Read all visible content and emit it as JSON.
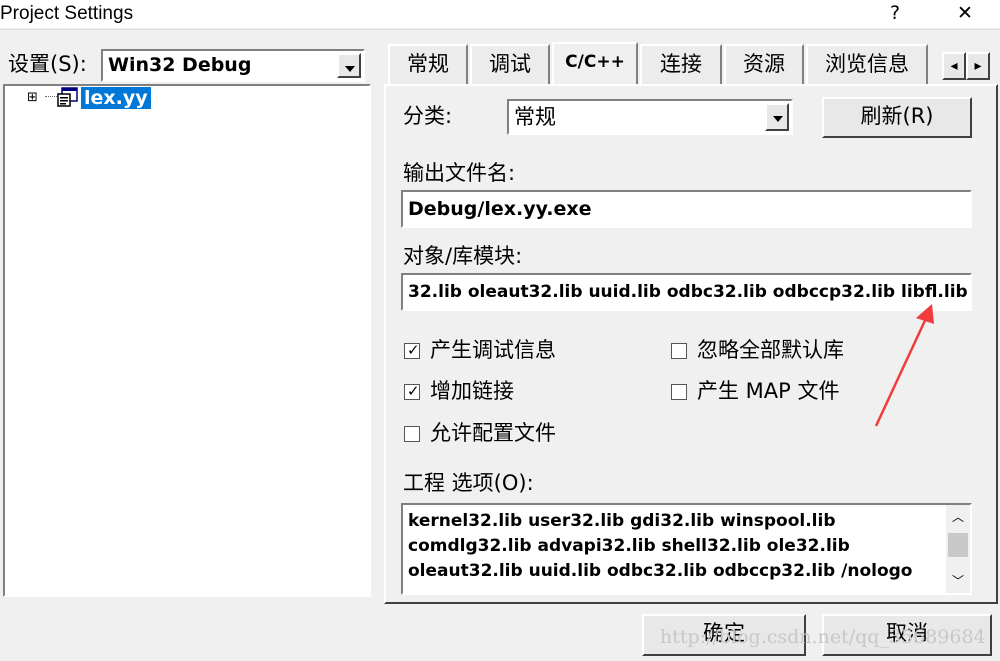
{
  "window": {
    "title": "Project Settings",
    "help_glyph": "?",
    "close_glyph": "✕"
  },
  "left": {
    "settings_label": "设置(S):",
    "config_value": "Win32 Debug",
    "tree_expander": "⊞",
    "tree_item": "lex.yy"
  },
  "tabs": [
    "常规",
    "调试",
    "C/C++",
    "连接",
    "资源",
    "浏览信息"
  ],
  "tab_scroll": {
    "left": "◂",
    "right": "▸"
  },
  "panel": {
    "category_label": "分类:",
    "category_value": "常规",
    "reset_button": "刷新(R)",
    "output_label": "输出文件名:",
    "output_value": "Debug/lex.yy.exe",
    "modules_label": "对象/库模块:",
    "modules_value": "32.lib oleaut32.lib uuid.lib odbc32.lib odbccp32.lib libfl.lib",
    "checkboxes": [
      {
        "label": "产生调试信息",
        "checked": true,
        "mark": "✓"
      },
      {
        "label": "增加链接",
        "checked": true,
        "mark": "✓"
      },
      {
        "label": "允许配置文件",
        "checked": false,
        "mark": ""
      },
      {
        "label": "忽略全部默认库",
        "checked": false,
        "mark": ""
      },
      {
        "label": "产生 MAP 文件",
        "checked": false,
        "mark": ""
      }
    ],
    "options_label": "工程 选项(O):",
    "options_lines": [
      "kernel32.lib user32.lib gdi32.lib winspool.lib",
      "comdlg32.lib advapi32.lib shell32.lib ole32.lib",
      "oleaut32.lib uuid.lib odbc32.lib odbccp32.lib /nologo"
    ],
    "scroll_up": "︿",
    "scroll_down": "﹀"
  },
  "buttons": {
    "ok": "确定",
    "cancel": "取消"
  },
  "watermark": "http://blog.csdn.net/qq_35689684",
  "colors": {
    "selection": "#0078d7",
    "arrow": "#f03c3c"
  }
}
